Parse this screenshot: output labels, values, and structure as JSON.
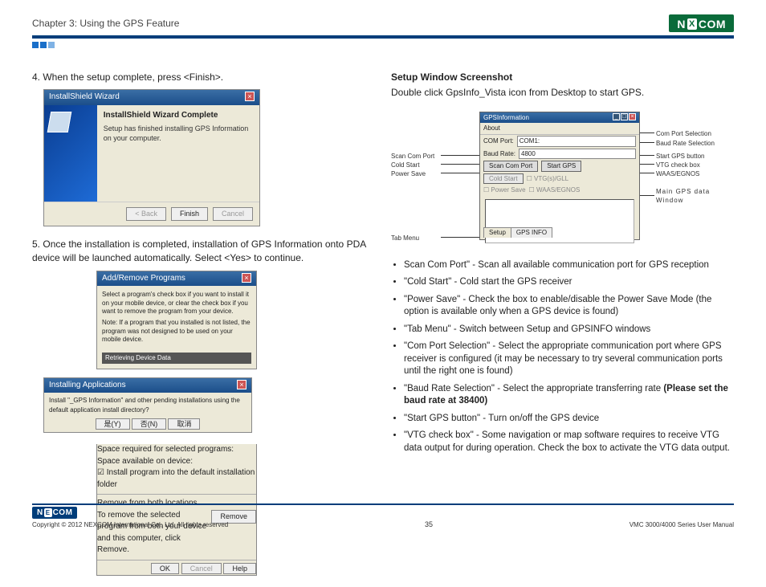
{
  "header": {
    "chapter": "Chapter 3: Using the GPS Feature",
    "logo": "NE COM",
    "logo_e": "X"
  },
  "left": {
    "step4_num": "4.",
    "step4_text": "When the setup complete, press <Finish>.",
    "win1": {
      "title": "InstallShield Wizard",
      "heading": "InstallShield Wizard Complete",
      "body": "Setup has finished installing GPS Information on your computer.",
      "back": "< Back",
      "finish": "Finish",
      "cancel": "Cancel"
    },
    "step5_num": "5.",
    "step5_text": "Once the installation is completed, installation of GPS Information onto PDA device will be launched automatically. Select <Yes> to continue.",
    "win2": {
      "title": "Add/Remove Programs",
      "body1": "Select a program's check box if you want to install it on your mobile device, or clear the check box if you want to remove the program from your device.",
      "body2": "Note: If a program that you installed is not listed, the program was not designed to be used on your mobile device.",
      "grey": "Retrieving Device Data"
    },
    "win3": {
      "title": "Installing Applications",
      "body": "Install \"_GPS Information\" and other pending installations using the default application install directory?",
      "yes": "是(Y)",
      "no": "否(N)",
      "cancel": "取消"
    },
    "win4": {
      "space1": "Space required for selected programs:",
      "space2": "Space available on device:",
      "chk": "Install program into the default installation folder",
      "remove_h": "Remove from both locations",
      "remove_t": "To remove the selected program from both your device and this computer, click Remove.",
      "remove_b": "Remove",
      "ok": "OK",
      "cancel": "Cancel",
      "help": "Help"
    }
  },
  "right": {
    "heading": "Setup Window Screenshot",
    "intro": "Double click GpsInfo_Vista icon from Desktop to start GPS.",
    "gwin": {
      "title": "GPSInformation",
      "menu": "About",
      "com_label": "COM Port:",
      "com_val": "COM1:",
      "baud_label": "Baud Rate:",
      "baud_val": "4800",
      "scan": "Scan Com Port",
      "start": "Start GPS",
      "cold": "Cold Start",
      "vtg": "VTG(s)/GLL",
      "power": "Power Save",
      "waas": "WAAS/EGNOS",
      "tab1": "Setup",
      "tab2": "GPS INFO"
    },
    "labels": {
      "l_scan": "Scan Com Port",
      "l_cold": "Cold Start",
      "l_power": "Power Save",
      "l_tab": "Tab Menu",
      "r_com": "Com Port Selection",
      "r_baud": "Baud Rate Selection",
      "r_start": "Start GPS button",
      "r_vtg": "VTG check box",
      "r_waas": "WAAS/EGNOS",
      "r_main": "Main GPS data Window"
    },
    "bullets": [
      "Scan Com Port\" - Scan all available communication port for GPS reception",
      "\"Cold Start\" - Cold start the GPS receiver",
      "\"Power Save\" - Check the box to enable/disable the Power Save Mode (the option is available only when a GPS device is found)",
      "\"Tab Menu\" - Switch between Setup and GPSINFO windows",
      "\"Com Port Selection\" - Select the appropriate communication port where GPS receiver is configured (it may be necessary to try several communication ports until the right one is found)",
      "\"Baud Rate Selection\" - Select the appropriate transferring rate ",
      "\"Start GPS button\" - Turn on/off the GPS device",
      "\"VTG check box\" - Some navigation or map software requires to receive VTG data output for during operation. Check the box to activate the VTG data output."
    ],
    "bullet_bold": "(Please set the baud rate at 38400)"
  },
  "footer": {
    "copy": "Copyright © 2012 NEXCOM International Co., Ltd. All rights reserved",
    "page": "35",
    "doc": "VMC 3000/4000 Series User Manual"
  }
}
